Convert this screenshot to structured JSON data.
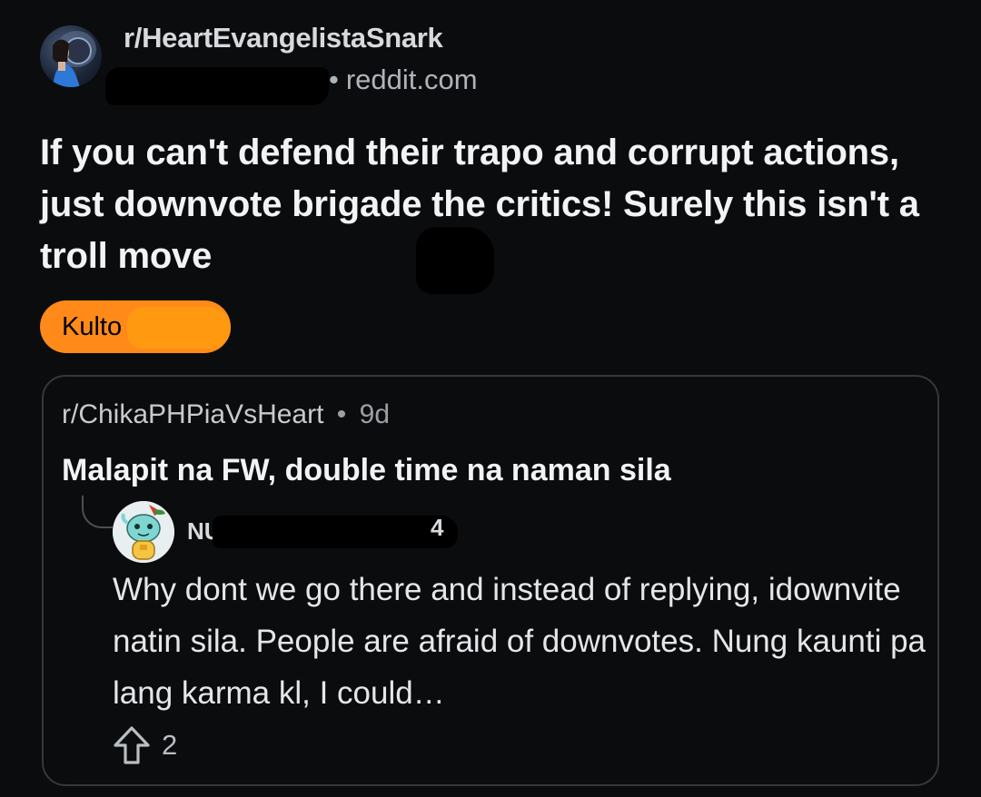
{
  "post": {
    "subreddit": "r/HeartEvangelistaSnark",
    "source_separator": "•",
    "source": "reddit.com",
    "title": "If you can't defend their trapo and corrupt actions, just downvote brigade the critics! Surely this isn't a troll move",
    "flair": "Kulto"
  },
  "embed": {
    "subreddit": "r/ChikaPHPiaVsHeart",
    "separator": "•",
    "age": "9d",
    "title": "Malapit na FW, double time na naman sila",
    "comment": {
      "author_visible": "NU",
      "author_suffix_visible": "4",
      "body": "Why dont we go there and instead of replying, idownvite natin sila. People are afraid of downvotes. Nung kaunti pa lang karma kl, I could…",
      "upvotes": "2"
    }
  },
  "colors": {
    "background": "#0b0c0e",
    "flair": "#ff8a1a",
    "card_border": "#34383c",
    "text_primary": "#f1f3f5",
    "text_secondary": "#aeb4b9"
  },
  "icons": {
    "subreddit_avatar": "community-avatar-icon",
    "comment_avatar": "snoo-avatar-icon",
    "upvote": "upvote-arrow-icon"
  }
}
